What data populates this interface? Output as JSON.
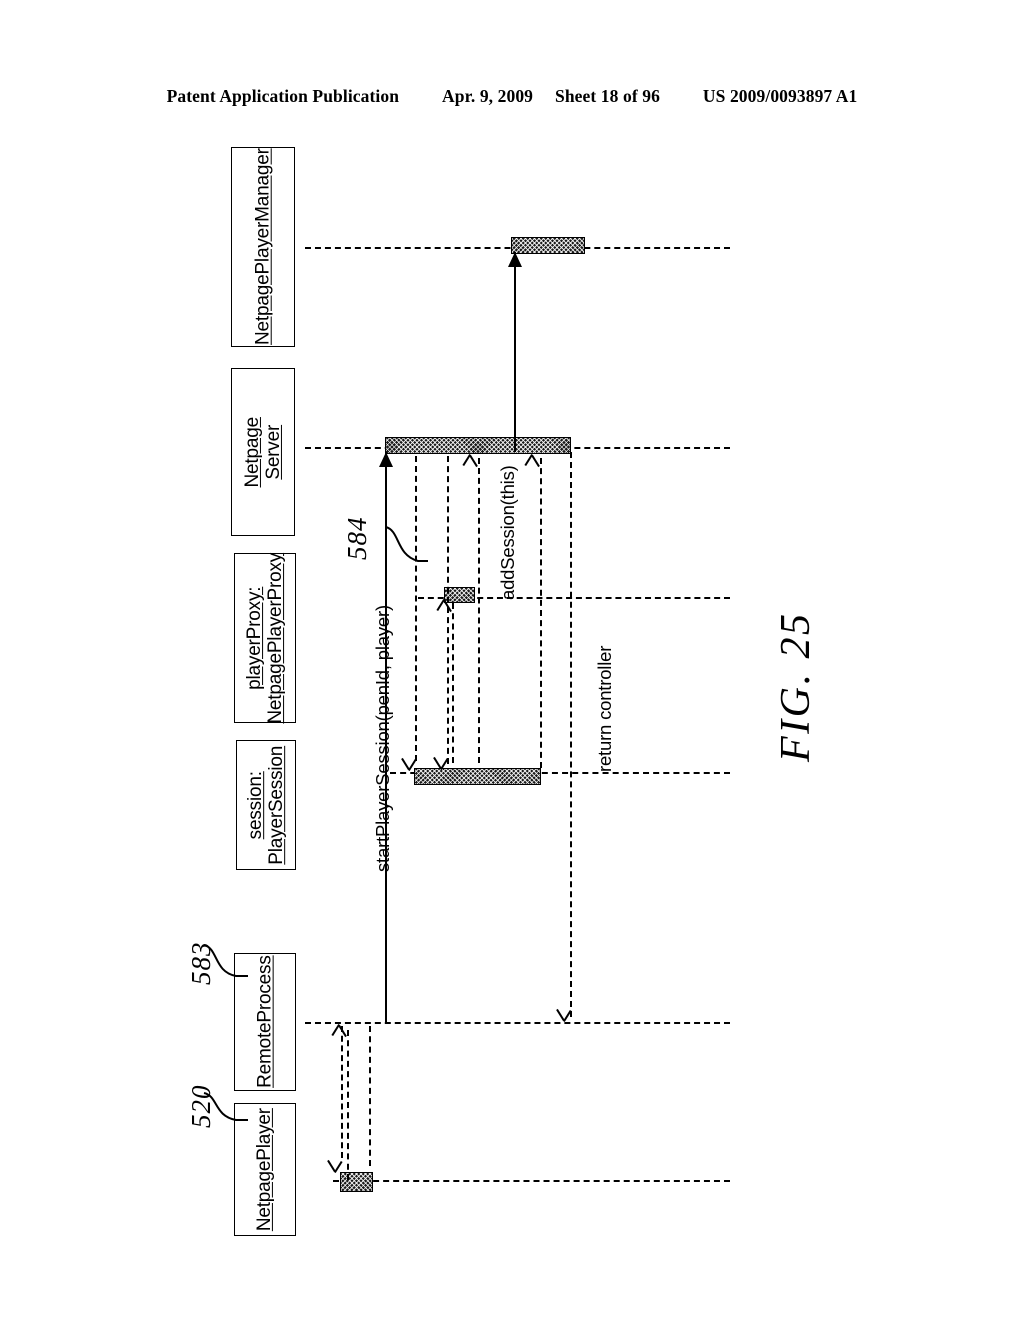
{
  "header": {
    "publication": "Patent Application Publication",
    "date": "Apr. 9, 2009",
    "sheet": "Sheet 18 of 96",
    "patent_number": "US 2009/0093897 A1"
  },
  "figure": {
    "caption": "FIG. 25",
    "type": "uml-sequence-diagram",
    "orientation": "rotated-90-ccw"
  },
  "participants": [
    {
      "id": "netpage-player-manager",
      "lines": [
        "NetpagePlayerManager"
      ]
    },
    {
      "id": "netpage-server",
      "lines": [
        "Netpage",
        "Server"
      ]
    },
    {
      "id": "player-proxy",
      "lines": [
        "playerProxy:",
        "NetpagePlayerProxy"
      ]
    },
    {
      "id": "session",
      "lines": [
        "session:",
        "PlayerSession"
      ]
    },
    {
      "id": "remote-process",
      "lines": [
        "RemoteProcess"
      ]
    },
    {
      "id": "netpage-player",
      "lines": [
        "NetpagePlayer"
      ]
    }
  ],
  "messages": [
    {
      "id": "start-player-session",
      "label": "startPlayerSession(penId, player)"
    },
    {
      "id": "add-session",
      "label": "addSession(this)"
    },
    {
      "id": "return-controller",
      "label": "return controller"
    }
  ],
  "reference_numerals": [
    {
      "id": "ref-583",
      "value": "583"
    },
    {
      "id": "ref-520",
      "value": "520"
    },
    {
      "id": "ref-584",
      "value": "584"
    }
  ]
}
